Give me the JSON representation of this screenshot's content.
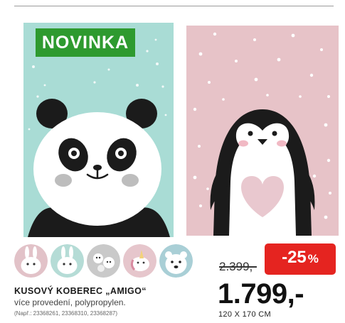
{
  "badge": {
    "label": "NOVINKA",
    "color": "#2e9a2f"
  },
  "rugs": [
    {
      "name": "panda",
      "background": "#a9dcd5"
    },
    {
      "name": "penguin",
      "background": "#e7c3c8"
    }
  ],
  "variants": [
    {
      "name": "pink-bunny"
    },
    {
      "name": "mint-bunny"
    },
    {
      "name": "grey-animals"
    },
    {
      "name": "pink-unicorn"
    },
    {
      "name": "white-bear"
    }
  ],
  "product": {
    "name": "KUSOVÝ KOBEREC „AMIGO“",
    "description": "více provedení, polypropylen.",
    "codes": "(Např.: 23368261, 23368310, 23368287)"
  },
  "pricing": {
    "old_price": "2.399,-",
    "discount": "-25",
    "discount_sign": "%",
    "discount_color": "#e52420",
    "new_price": "1.799,-",
    "dimensions": "120 X 170 CM"
  }
}
